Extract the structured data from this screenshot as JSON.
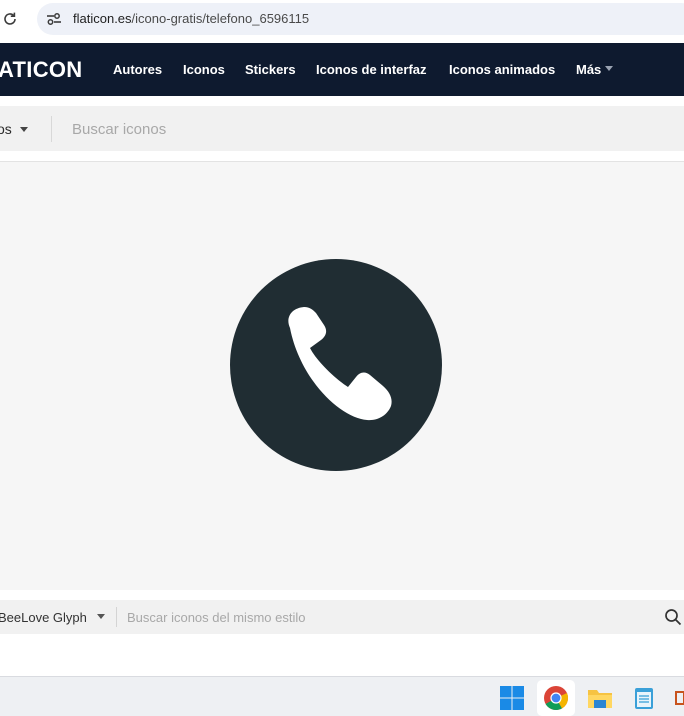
{
  "browser": {
    "url_host": "flaticon.es",
    "url_path": "/icono-gratis/telefono_6596115"
  },
  "nav": {
    "logo": "ATICON",
    "items": [
      "Autores",
      "Iconos",
      "Stickers",
      "Iconos de interfaz",
      "Iconos animados",
      "Más"
    ]
  },
  "search": {
    "filter": "os",
    "placeholder": "Buscar iconos"
  },
  "preview": {
    "icon": "phone-icon",
    "circle_color": "#202d33",
    "glyph_color": "#ffffff"
  },
  "style_bar": {
    "style_name": "BeeLove Glyph",
    "placeholder": "Buscar iconos del mismo estilo"
  },
  "taskbar": {
    "icons": [
      "windows-start-icon",
      "chrome-icon",
      "file-explorer-icon",
      "notepad-icon",
      "app-icon"
    ]
  }
}
